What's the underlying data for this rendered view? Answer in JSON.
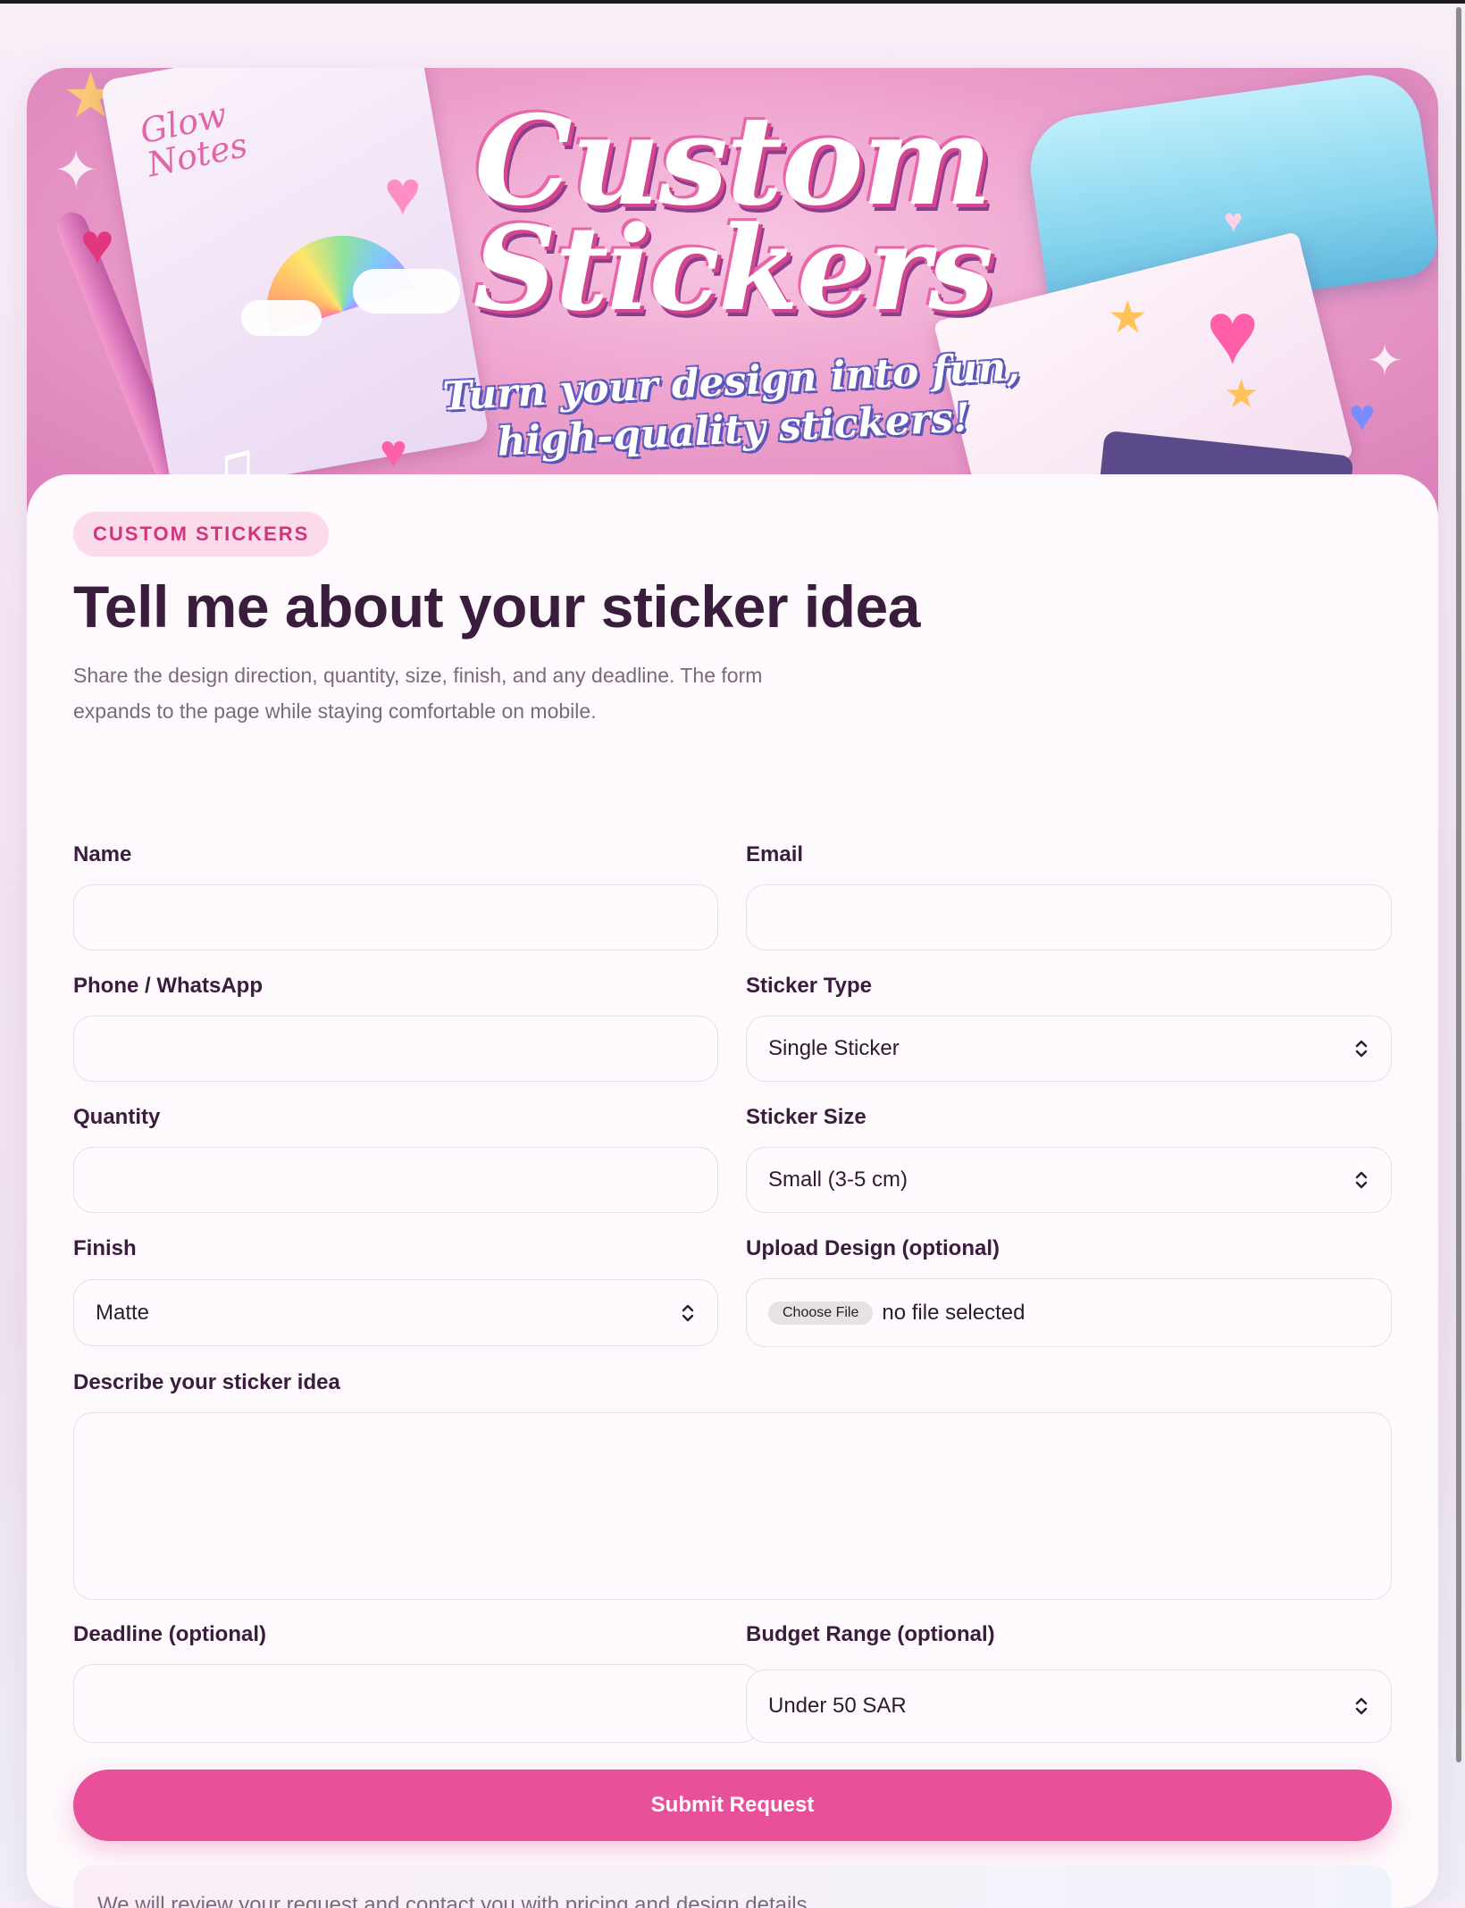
{
  "banner": {
    "notebook_text": "Glow Notes",
    "title_line1": "Custom",
    "title_line2": "Stickers",
    "tagline_line1": "Turn your design into fun,",
    "tagline_line2": "high-quality stickers!"
  },
  "header": {
    "eyebrow": "CUSTOM STICKERS",
    "title": "Tell me about your sticker idea",
    "description": "Share the design direction, quantity, size, finish, and any deadline. The form expands to the page while staying comfortable on mobile."
  },
  "form": {
    "name_label": "Name",
    "email_label": "Email",
    "phone_label": "Phone / WhatsApp",
    "sticker_type_label": "Sticker Type",
    "sticker_type_value": "Single Sticker",
    "quantity_label": "Quantity",
    "sticker_size_label": "Sticker Size",
    "sticker_size_value": "Small (3-5 cm)",
    "finish_label": "Finish",
    "finish_value": "Matte",
    "upload_label": "Upload Design (optional)",
    "choose_file_label": "Choose File",
    "file_status": "no file selected",
    "describe_label": "Describe your sticker idea",
    "deadline_label": "Deadline (optional)",
    "budget_label": "Budget Range (optional)",
    "budget_value": "Under 50 SAR",
    "submit_label": "Submit Request",
    "note": "We will review your request and contact you with pricing and design details."
  },
  "colors": {
    "accent": "#e8509a",
    "eyebrow_bg": "#fbdbe9",
    "eyebrow_text": "#d0347f",
    "heading": "#3a1c3c"
  }
}
